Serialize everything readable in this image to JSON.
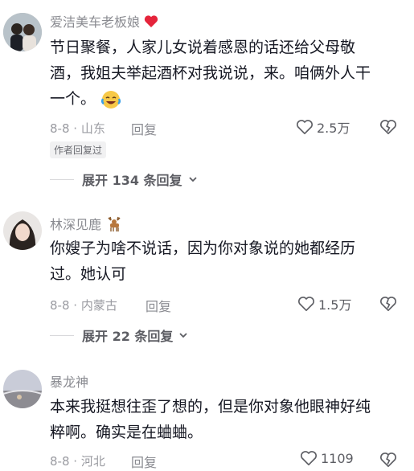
{
  "comments": [
    {
      "username": "爱洁美车老板娘",
      "text_lines": [
        "节日聚餐，人家儿女说着感恩的话还给父母敬",
        "酒，我姐夫举起酒杯对我说说，来。咱俩外人干",
        "一个。"
      ],
      "date": "8-8",
      "location": "山东",
      "reply_label": "回复",
      "likes": "2.5万",
      "tag": "作者回复过",
      "expand_label": "展开 134 条回复",
      "name_emoji": "red-heart-icon",
      "text_emoji": "crying-laughing-emoji"
    },
    {
      "username": "林深见鹿",
      "text_lines": [
        "你嫂子为啥不说话，因为你对象说的她都经历",
        "过。她认可"
      ],
      "date": "8-8",
      "location": "内蒙古",
      "reply_label": "回复",
      "likes": "1.5万",
      "expand_label": "展开 22 条回复",
      "name_emoji": "deer-icon"
    },
    {
      "username": "暴龙神",
      "text_lines": [
        "本来我挺想往歪了想的，但是你对象他眼神好纯",
        "粹啊。确实是在蛐蛐。"
      ],
      "date": "8-8",
      "location": "河北",
      "reply_label": "回复",
      "likes": "1109"
    }
  ],
  "colors": {
    "heart_red": "#e5243b",
    "text": "#161823",
    "muted": "#8a8b91"
  }
}
